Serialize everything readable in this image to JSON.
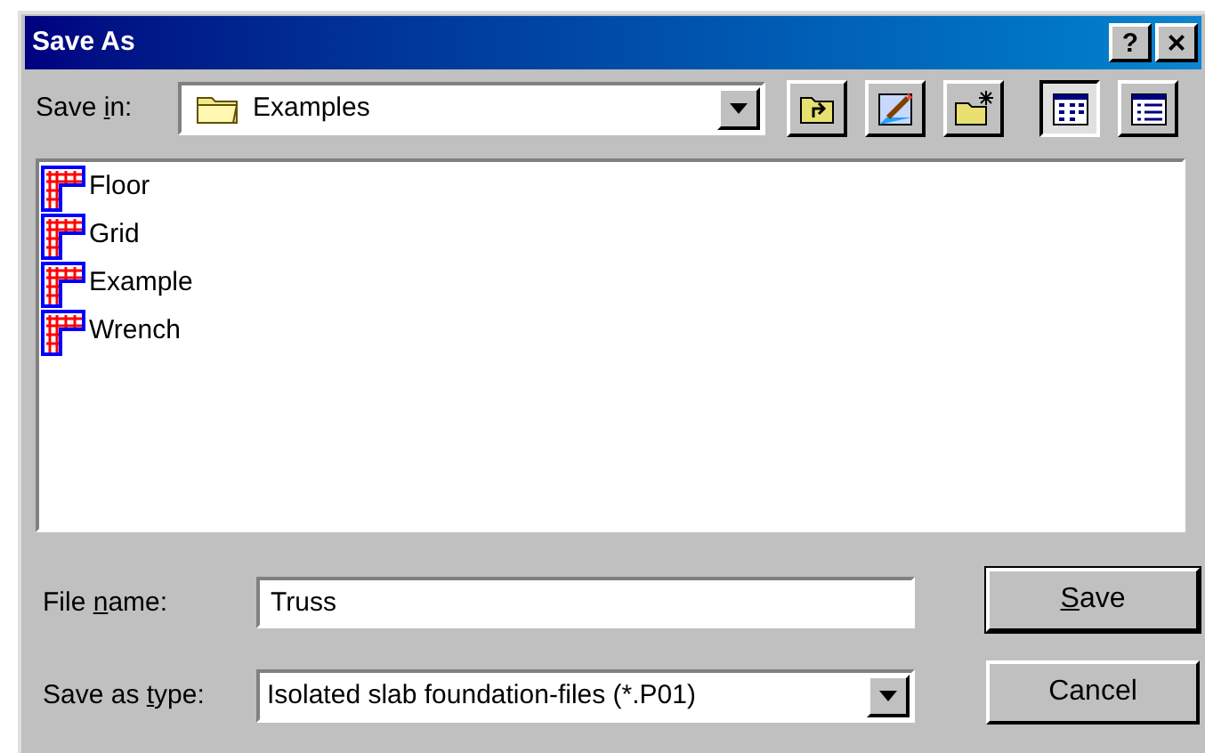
{
  "window": {
    "title": "Save As",
    "help_button": "?",
    "close_button": "×"
  },
  "save_in": {
    "label_parts": [
      "Save ",
      "i",
      "n:"
    ],
    "value": "Examples"
  },
  "toolbar": [
    {
      "kind": "up"
    },
    {
      "kind": "desktop"
    },
    {
      "kind": "new-folder"
    },
    {
      "kind": "list",
      "selected": true
    },
    {
      "kind": "details",
      "selected": false
    }
  ],
  "files": [
    {
      "name": "Floor"
    },
    {
      "name": "Grid"
    },
    {
      "name": "Example"
    },
    {
      "name": "Wrench"
    }
  ],
  "file_name": {
    "label_parts": [
      "File ",
      "n",
      "ame:"
    ],
    "value": "Truss"
  },
  "save_as_type": {
    "label_parts": [
      "Save as ",
      "t",
      "ype:"
    ],
    "value": "Isolated slab foundation-files (*.P01)"
  },
  "buttons": [
    {
      "label_parts": {
        "key": "S",
        "after": "ave"
      },
      "default": true
    },
    {
      "label_parts": {
        "before": "Cancel"
      },
      "default": false
    }
  ]
}
